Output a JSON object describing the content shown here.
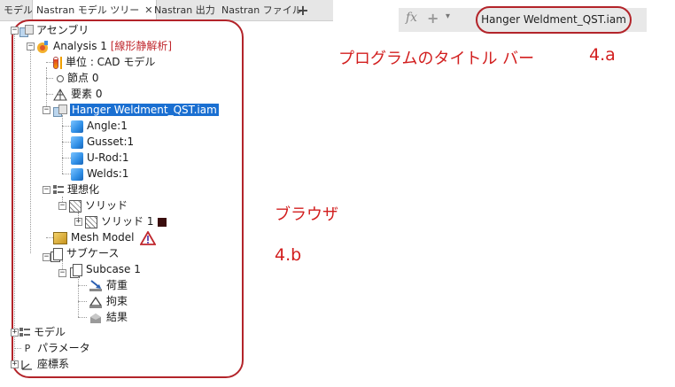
{
  "tabs": [
    {
      "label": "モデル",
      "active": false
    },
    {
      "label": "Nastran モデル ツリー",
      "active": true,
      "close": "✕"
    },
    {
      "label": "Nastran 出力",
      "active": false
    },
    {
      "label": "Nastran ファイル",
      "active": false
    }
  ],
  "tab_add_glyph": "+",
  "titlebar": {
    "fx_label": "fx",
    "plus_glyph": "+",
    "more_glyph": "▾",
    "document_title": "Hanger Weldment_QST.iam"
  },
  "tree": {
    "root": "アセンブリ",
    "analysis": {
      "name": "Analysis 1",
      "type": "[線形静解析]"
    },
    "units": "単位 : CAD モデル",
    "nodes": "節点 0",
    "elements": "要素 0",
    "assembly_file": "Hanger Weldment_QST.iam",
    "parts": [
      "Angle:1",
      "Gusset:1",
      "U-Rod:1",
      "Welds:1"
    ],
    "idealization": "理想化",
    "solid_group": "ソリッド",
    "solid_item": "ソリッド 1",
    "mesh_model": "Mesh Model",
    "subcases": "サブケース",
    "subcase_1": "Subcase 1",
    "loads": "荷重",
    "constraints": "拘束",
    "results": "結果",
    "model": "モデル",
    "parameters": "パラメータ",
    "parameters_icon": "P",
    "coordinate_systems": "座標系"
  },
  "colors": {
    "annotation": "#d21e1e",
    "outline": "#b3242a",
    "selection": "#1a6fd1",
    "solid_swatch": "#3a0d0d"
  },
  "annotations": {
    "title_bar_label": "プログラムのタイトル バー",
    "title_bar_ref": "4.a",
    "browser_label": "ブラウザ",
    "browser_ref": "4.b"
  }
}
